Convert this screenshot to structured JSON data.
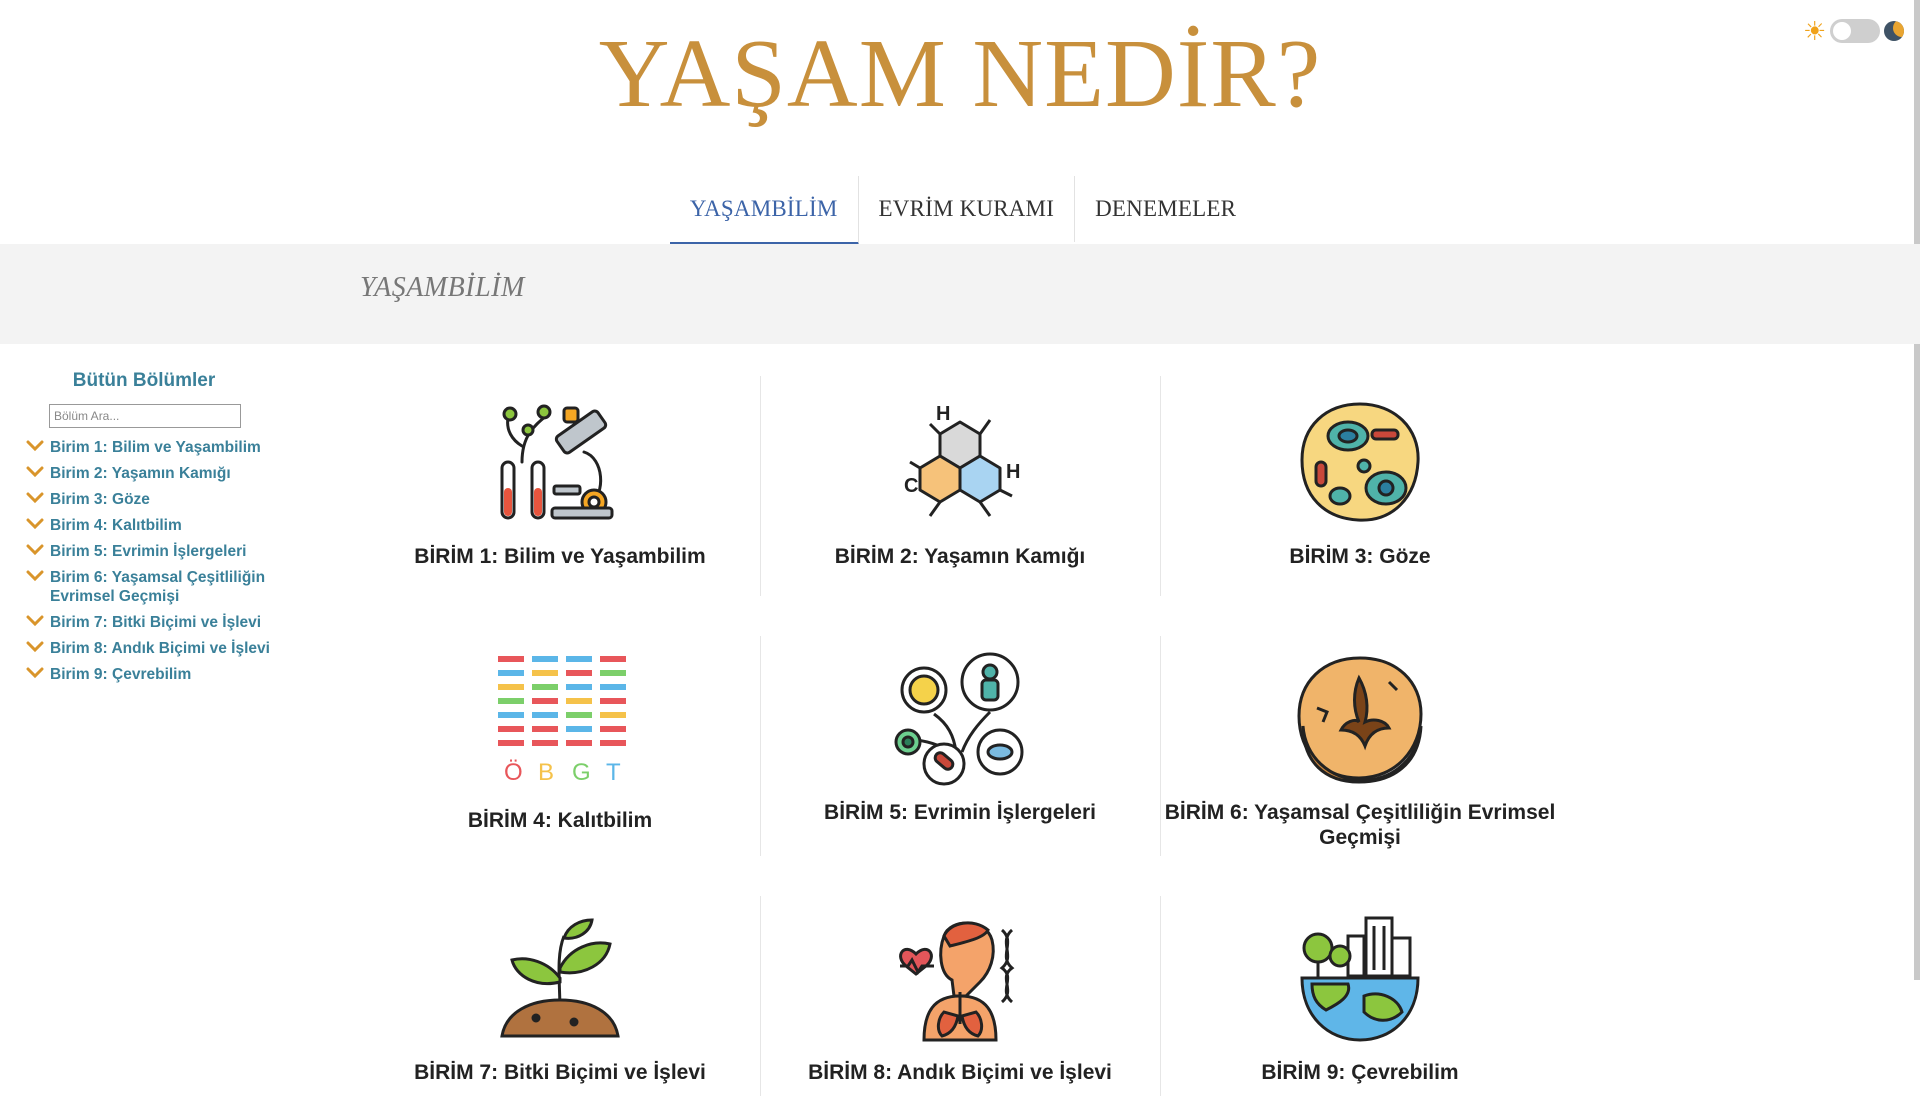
{
  "header": {
    "title": "YAŞAM NEDİR?"
  },
  "theme": {
    "sun_glyph": "☀"
  },
  "nav": {
    "tabs": [
      {
        "label": "YAŞAMBİLİM",
        "active": true
      },
      {
        "label": "EVRİM KURAMI",
        "active": false
      },
      {
        "label": "DENEMELER",
        "active": false
      }
    ]
  },
  "banner": {
    "title": "YAŞAMBİLİM"
  },
  "sidebar": {
    "title": "Bütün Bölümler",
    "search_placeholder": "Bölüm Ara...",
    "items": [
      {
        "label": "Birim 1: Bilim ve Yaşambilim"
      },
      {
        "label": "Birim 2: Yaşamın Kamığı"
      },
      {
        "label": "Birim 3: Göze"
      },
      {
        "label": "Birim 4: Kalıtbilim"
      },
      {
        "label": "Birim 5: Evrimin İşlergeleri"
      },
      {
        "label": "Birim 6: Yaşamsal Çeşitliliğin Evrimsel Geçmişi"
      },
      {
        "label": "Birim 7: Bitki Biçimi ve İşlevi"
      },
      {
        "label": "Birim 8: Andık Biçimi ve İşlevi"
      },
      {
        "label": "Birim 9: Çevrebilim"
      }
    ]
  },
  "cards": [
    {
      "label": "BİRİM 1: Bilim ve Yaşambilim",
      "icon": "microscope-icon"
    },
    {
      "label": "BİRİM 2: Yaşamın Kamığı",
      "icon": "molecule-icon"
    },
    {
      "label": "BİRİM 3: Göze",
      "icon": "cell-icon"
    },
    {
      "label": "BİRİM 4: Kalıtbilim",
      "icon": "dna-bands-icon",
      "letters": [
        "Ö",
        "B",
        "G",
        "T"
      ]
    },
    {
      "label": "BİRİM 5: Evrimin İşlergeleri",
      "icon": "evolution-bubbles-icon"
    },
    {
      "label": "BİRİM 6: Yaşamsal Çeşitliliğin Evrimsel Geçmişi",
      "icon": "fossil-icon"
    },
    {
      "label": "BİRİM 7: Bitki Biçimi ve İşlevi",
      "icon": "sprout-icon"
    },
    {
      "label": "BİRİM 8: Andık Biçimi ve İşlevi",
      "icon": "anatomy-icon"
    },
    {
      "label": "BİRİM 9: Çevrebilim",
      "icon": "earth-city-icon"
    }
  ],
  "colors": {
    "brand": "#c8903c",
    "nav_active": "#3c64a8",
    "sidebar_link": "#3a8099",
    "chevron": "#d9952b",
    "banner_bg": "#f3f3f3"
  }
}
